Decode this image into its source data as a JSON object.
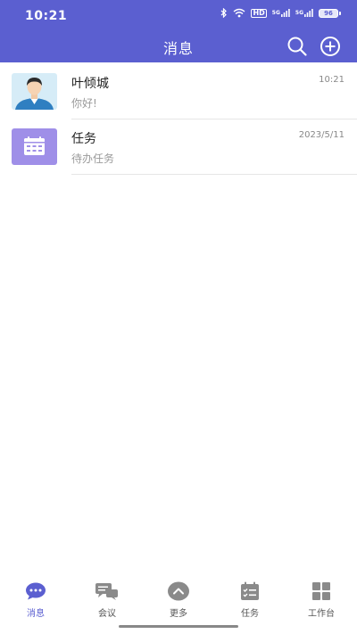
{
  "status_bar": {
    "time": "10:21",
    "bluetooth": "bluetooth-icon",
    "wifi": "wifi-icon",
    "hd": "HD",
    "signal1": "5G",
    "signal2": "5G",
    "battery": "96"
  },
  "header": {
    "title": "消息",
    "search_icon": "search-icon",
    "add_icon": "plus-circle-icon",
    "color": "#5b5fd0"
  },
  "conversations": [
    {
      "name": "叶倾城",
      "preview": "你好!",
      "time": "10:21",
      "avatar": "person-avatar"
    },
    {
      "name": "任务",
      "preview": "待办任务",
      "time": "2023/5/11",
      "avatar": "calendar-icon"
    }
  ],
  "tabbar": {
    "items": [
      {
        "label": "消息",
        "icon": "chat-bubble-icon",
        "active": true
      },
      {
        "label": "会议",
        "icon": "meeting-icon",
        "active": false
      },
      {
        "label": "更多",
        "icon": "chevron-up-icon",
        "active": false
      },
      {
        "label": "任务",
        "icon": "task-list-icon",
        "active": false
      },
      {
        "label": "工作台",
        "icon": "grid-icon",
        "active": false
      }
    ]
  }
}
